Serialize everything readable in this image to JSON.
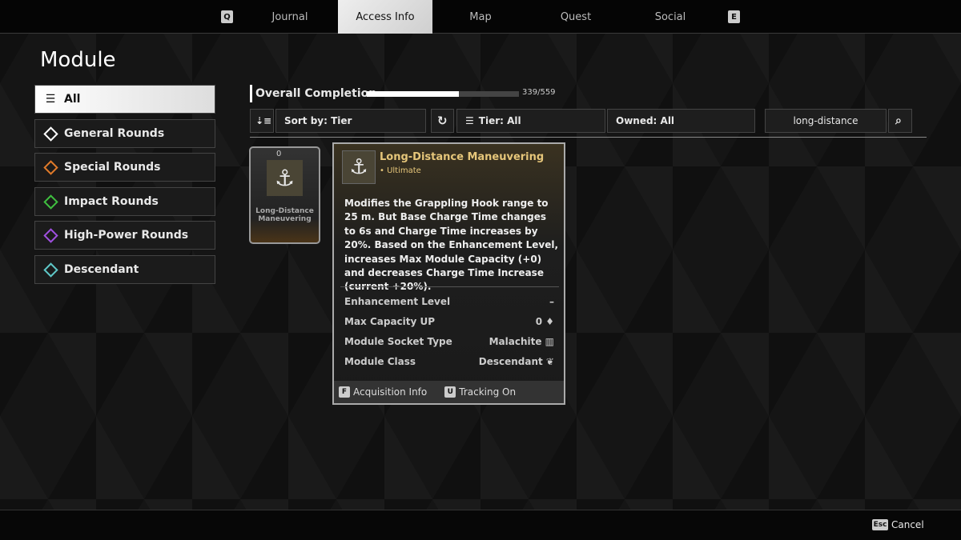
{
  "nav": {
    "left_key": "Q",
    "right_key": "E",
    "tabs": [
      {
        "label": "Journal"
      },
      {
        "label": "Access Info",
        "active": true
      },
      {
        "label": "Map"
      },
      {
        "label": "Quest"
      },
      {
        "label": "Social"
      }
    ]
  },
  "page_title": "Module",
  "sidebar": {
    "items": [
      {
        "label": "All",
        "icon": "layers-icon",
        "active": true
      },
      {
        "label": "General Rounds",
        "icon": "general-rounds-icon",
        "color": "#ffffff"
      },
      {
        "label": "Special Rounds",
        "icon": "special-rounds-icon",
        "color": "#e07a2a"
      },
      {
        "label": "Impact Rounds",
        "icon": "impact-rounds-icon",
        "color": "#3fbf3f"
      },
      {
        "label": "High-Power Rounds",
        "icon": "high-power-rounds-icon",
        "color": "#a050e0"
      },
      {
        "label": "Descendant",
        "icon": "descendant-icon",
        "color": "#5fc8c8"
      }
    ]
  },
  "completion": {
    "label": "Overall Completion",
    "count": "339/559",
    "progress": 0.606
  },
  "filters": {
    "sort": "Sort by: Tier",
    "tier": "Tier: All",
    "owned": "Owned: All",
    "search_value": "long-distance"
  },
  "module_card": {
    "name": "Long-Distance Maneuvering",
    "capacity": "0"
  },
  "tooltip": {
    "name": "Long-Distance Maneuvering",
    "tier": "• Ultimate",
    "description": "Modifies the Grappling Hook range to 25 m. But Base Charge Time changes to 6s and Charge Time increases by 20%. Based on the Enhancement Level, increases Max Module Capacity (+0) and decreases Charge Time Increase (current +20%).",
    "stats": [
      {
        "label": "Enhancement Level",
        "value": "–"
      },
      {
        "label": "Max Capacity UP",
        "value": "0 ♦"
      },
      {
        "label": "Module Socket Type",
        "value": "Malachite ▥"
      },
      {
        "label": "Module Class",
        "value": "Descendant ❦"
      }
    ],
    "footer": [
      {
        "key": "F",
        "label": "Acquisition Info"
      },
      {
        "key": "U",
        "label": "Tracking On"
      }
    ]
  },
  "cancel": {
    "key": "Esc",
    "label": "Cancel"
  }
}
